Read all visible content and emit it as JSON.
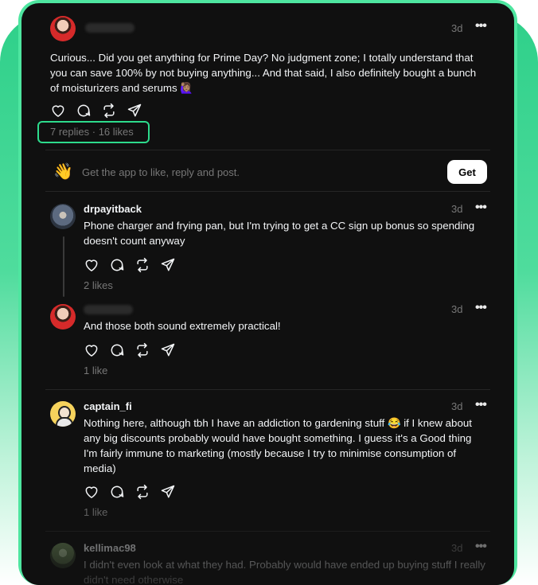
{
  "main_post": {
    "time": "3d",
    "text": "Curious... Did you get anything for Prime Day? No judgment zone; I totally understand that you can save 100% by not buying anything... And that said, I also definitely bought a bunch of moisturizers and serums 🙋🏽‍♀️",
    "stats": "7 replies · 16 likes"
  },
  "app_prompt": {
    "emoji": "👋",
    "text": "Get the app to like, reply and post.",
    "button": "Get"
  },
  "replies": [
    {
      "username": "drpayitback",
      "time": "3d",
      "text": "Phone charger and frying pan, but I'm trying to get a CC sign up bonus so spending doesn't count anyway",
      "stats": "2 likes"
    },
    {
      "username": "",
      "time": "3d",
      "text": "And those both sound extremely practical!",
      "stats": "1 like"
    },
    {
      "username": "captain_fi",
      "time": "3d",
      "text": "Nothing here, although tbh I have an addiction to gardening stuff 😂 if I knew about any big discounts probably would have bought something. I guess it's a Good thing I'm fairly immune to marketing (mostly because I try to minimise consumption of media)",
      "stats": "1 like"
    },
    {
      "username": "kellimac98",
      "time": "3d",
      "text": "I didn't even look at what they had. Probably would have ended up buying stuff I really didn't need otherwise",
      "stats": ""
    }
  ],
  "icons": [
    "heart-icon",
    "comment-icon",
    "repost-icon",
    "share-icon",
    "more-icon"
  ],
  "colors": {
    "highlight": "#2ddb8c",
    "panel_bg": "#101010",
    "frame": "#4ee6a0"
  }
}
